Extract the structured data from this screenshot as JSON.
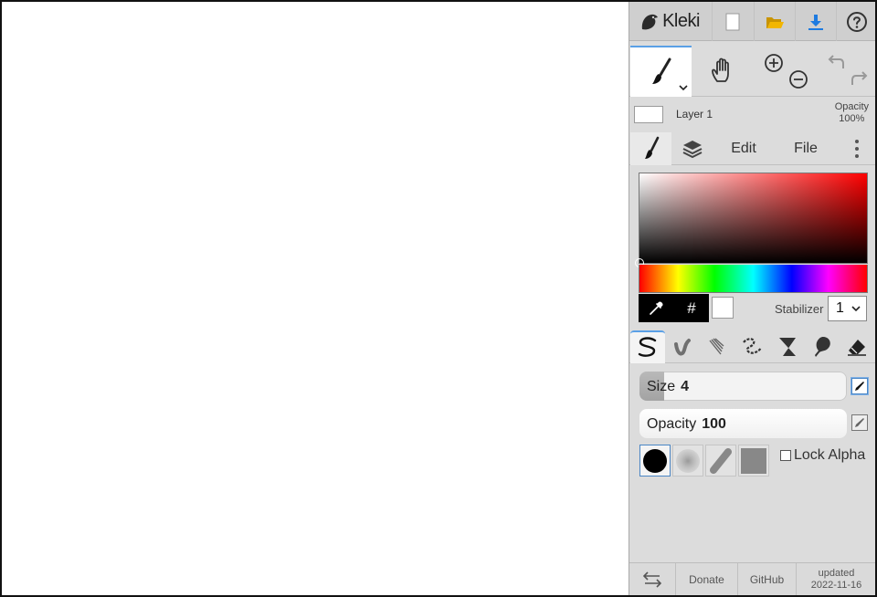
{
  "app": {
    "name": "Kleki"
  },
  "topbar": {
    "new_icon": "new-file-icon",
    "open_icon": "folder-icon",
    "download_icon": "download-icon",
    "help_icon": "help-icon"
  },
  "tools": {
    "brush_icon": "brush-icon",
    "hand_icon": "hand-icon",
    "zoom_in_icon": "zoom-in-icon",
    "zoom_out_icon": "zoom-out-icon",
    "undo_icon": "undo-icon",
    "redo_icon": "redo-icon"
  },
  "layer": {
    "name": "Layer 1",
    "opacity_label": "Opacity",
    "opacity_value": "100%"
  },
  "tabs": [
    {
      "label": "",
      "icon": "brush-icon"
    },
    {
      "label": "",
      "icon": "layers-icon"
    },
    {
      "label": "Edit"
    },
    {
      "label": "File"
    },
    {
      "label": "",
      "icon": "more-vertical-icon"
    }
  ],
  "color": {
    "hue_hex": "#ff0000",
    "primary_hex": "#000000",
    "secondary_hex": "#ffffff",
    "hex_button": "#"
  },
  "stabilizer": {
    "label": "Stabilizer",
    "value": "1"
  },
  "brushes": [
    "pen-brush-icon",
    "blend-brush-icon",
    "sketchy-brush-icon",
    "pixel-brush-icon",
    "chemy-brush-icon",
    "smudge-brush-icon",
    "eraser-icon"
  ],
  "size": {
    "label": "Size",
    "value": "4",
    "fill_fraction": 0.12
  },
  "opacity": {
    "label": "Opacity",
    "value": "100",
    "fill_fraction": 1.0
  },
  "lock_alpha": {
    "label": "Lock Alpha",
    "checked": false
  },
  "footer": {
    "swap_icon": "swap-icon",
    "donate": "Donate",
    "github": "GitHub",
    "updated_label": "updated",
    "updated_date": "2022-11-16"
  }
}
